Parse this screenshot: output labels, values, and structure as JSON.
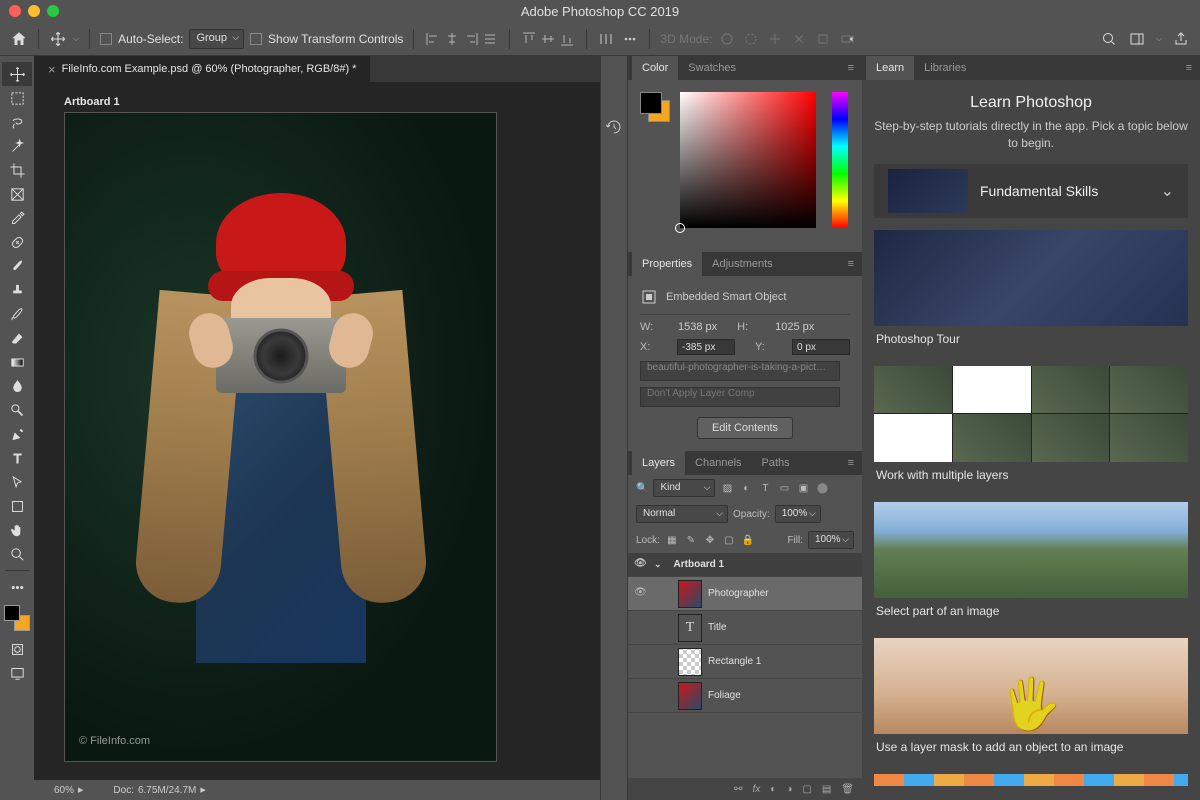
{
  "titlebar": {
    "title": "Adobe Photoshop CC 2019"
  },
  "optbar": {
    "autoselect_label": "Auto-Select:",
    "autoselect_value": "Group",
    "transform_label": "Show Transform Controls",
    "mode3d_label": "3D Mode:"
  },
  "doc": {
    "tab": "FileInfo.com Example.psd @ 60% (Photographer, RGB/8#) *",
    "artboard_label": "Artboard 1",
    "watermark": "© FileInfo.com",
    "zoom": "60%",
    "docsize_label": "Doc:",
    "docsize": "6.75M/24.7M"
  },
  "panels": {
    "color_tab": "Color",
    "swatches_tab": "Swatches",
    "properties_tab": "Properties",
    "adjustments_tab": "Adjustments",
    "layers_tab": "Layers",
    "channels_tab": "Channels",
    "paths_tab": "Paths"
  },
  "props": {
    "type_label": "Embedded Smart Object",
    "w_label": "W:",
    "w": "1538 px",
    "h_label": "H:",
    "h": "1025 px",
    "x_label": "X:",
    "x": "-385 px",
    "y_label": "Y:",
    "y": "0 px",
    "filename": "beautiful-photographer-is-taking-a-pict…",
    "layercomp": "Don't Apply Layer Comp",
    "edit_btn": "Edit Contents"
  },
  "layers": {
    "filter_label": "Kind",
    "blend": "Normal",
    "opacity_label": "Opacity:",
    "opacity": "100%",
    "lock_label": "Lock:",
    "fill_label": "Fill:",
    "fill": "100%",
    "items": [
      {
        "name": "Artboard 1",
        "art": true
      },
      {
        "name": "Photographer",
        "sel": true,
        "thumb": "img"
      },
      {
        "name": "Title",
        "thumb": "T"
      },
      {
        "name": "Rectangle 1",
        "thumb": "rect"
      },
      {
        "name": "Foliage",
        "thumb": "img"
      }
    ]
  },
  "learn": {
    "tab_learn": "Learn",
    "tab_lib": "Libraries",
    "title": "Learn Photoshop",
    "sub": "Step-by-step tutorials directly in the app. Pick a topic below to begin.",
    "accordion": "Fundamental Skills",
    "tiles": [
      "Photoshop Tour",
      "Work with multiple layers",
      "Select part of an image",
      "Use a layer mask to add an object to an image"
    ]
  }
}
